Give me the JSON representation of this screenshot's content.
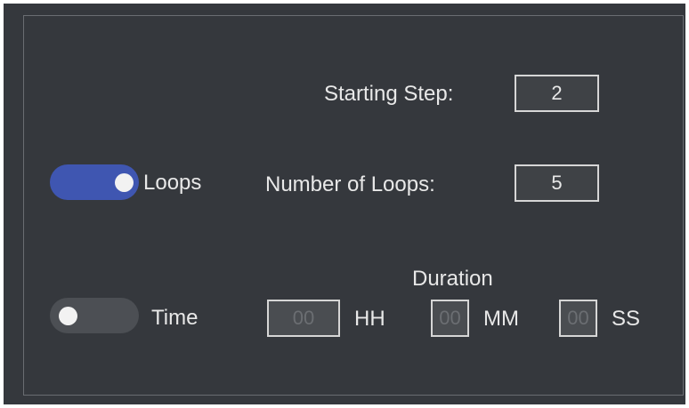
{
  "starting_step": {
    "label": "Starting Step:",
    "value": "2"
  },
  "loops": {
    "toggle_label": "Loops",
    "toggle_on": true,
    "number_label": "Number of Loops:",
    "number_value": "5"
  },
  "time": {
    "toggle_label": "Time",
    "toggle_on": false,
    "duration_label": "Duration",
    "hours": {
      "value": "00",
      "unit": "HH"
    },
    "minutes": {
      "value": "00",
      "unit": "MM"
    },
    "seconds": {
      "value": "00",
      "unit": "SS"
    }
  },
  "colors": {
    "background": "#35383d",
    "toggle_on": "#3f56b1",
    "toggle_off": "#4c4f54",
    "text": "#e8e8e8"
  }
}
